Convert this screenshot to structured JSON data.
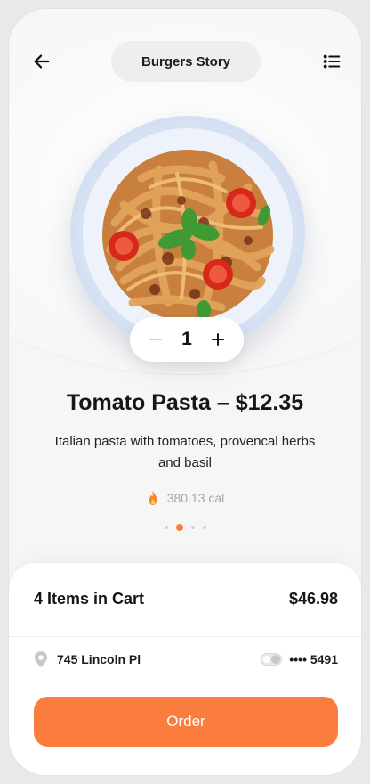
{
  "header": {
    "title": "Burgers Story",
    "back_icon": "arrow-left-icon",
    "menu_icon": "list-menu-icon"
  },
  "product": {
    "image": "pasta-plate-image",
    "quantity": "1",
    "title": "Tomato Pasta – $12.35",
    "description": "Italian pasta with tomatoes, provencal herbs and basil",
    "calories": "380.13 cal",
    "calories_icon": "fire-icon",
    "carousel_active_index": 1,
    "carousel_count": 4
  },
  "cart": {
    "items_label": "4 Items in Cart",
    "total": "$46.98",
    "address": "745 Lincoln Pl",
    "address_icon": "location-pin-icon",
    "card": "•••• 5491",
    "card_icon": "card-toggle-icon",
    "order_label": "Order"
  },
  "colors": {
    "accent": "#fb7d3e",
    "background": "#f6f6f7",
    "text": "#15151a",
    "muted": "#a7a7ac"
  }
}
